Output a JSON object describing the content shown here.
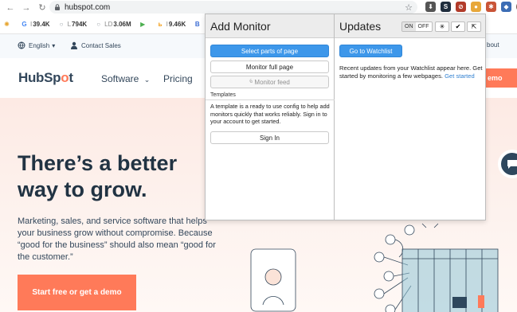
{
  "browser": {
    "url": "hubspot.com",
    "bookmarks": [
      {
        "label": "39.4K",
        "prefix": "I",
        "icon": "google-icon",
        "color": "#4285f4",
        "glyph": "G"
      },
      {
        "label": "794K",
        "prefix": "L",
        "icon": "circle-outline-icon",
        "color": "#9aa0a6",
        "glyph": "○"
      },
      {
        "label": "3.06M",
        "prefix": "LD",
        "icon": "circle-outline-icon",
        "color": "#9aa0a6",
        "glyph": "○"
      },
      {
        "label": "",
        "prefix": "",
        "icon": "play-icon",
        "color": "#4caf50",
        "glyph": "▶"
      },
      {
        "label": "9.46K",
        "prefix": "I",
        "icon": "amazon-icon",
        "color": "#f39c12",
        "glyph": "b"
      },
      {
        "label": "",
        "prefix": "",
        "icon": "b-icon",
        "color": "#3b6cd4",
        "glyph": "B"
      }
    ]
  },
  "hubspot": {
    "language": "English",
    "contact_sales": "Contact Sales",
    "about_fragment": "bout",
    "logo_pre": "HubSp",
    "logo_o": "o",
    "logo_post": "t",
    "nav_software": "Software",
    "nav_pricing": "Pricing",
    "nav_demo": "emo",
    "headline": "There’s a better way to grow.",
    "subtext": "Marketing, sales, and service software that helps your business grow without compromise. Because “good for the business” should also mean “good for the customer.”",
    "cta": "Start free or get a demo"
  },
  "popup": {
    "add_monitor_title": "Add Monitor",
    "btn_select_parts": "Select parts of page",
    "btn_monitor_full": "Monitor full page",
    "btn_monitor_feed": "Monitor feed",
    "templates_label": "Templates",
    "templates_text": "A template is a ready to use config to help add monitors quickly that works reliably. Sign in to your account to get started.",
    "btn_sign_in": "Sign In",
    "updates_title": "Updates",
    "toggle_on": "ON",
    "toggle_off": "OFF",
    "btn_watchlist": "Go to Watchlist",
    "updates_text": "Recent updates from your Watchlist appear here. Get started by monitoring a few webpages.",
    "get_started_link": "Get started",
    "accent_color": "#3d97ea"
  }
}
